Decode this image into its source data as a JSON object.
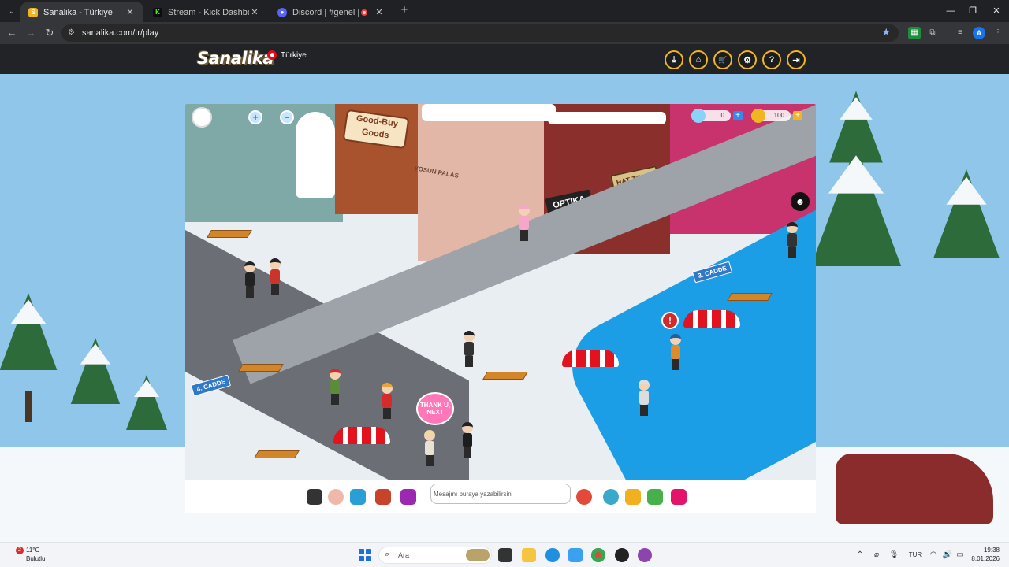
{
  "browser": {
    "tabs": [
      {
        "title": "Sanalika - Türkiye",
        "active": true,
        "favicon_color": "#f1b520"
      },
      {
        "title": "Stream - Kick Dashboard",
        "active": false,
        "favicon_color": "#53fc18"
      },
      {
        "title": "Discord | #genel | survivor",
        "active": false,
        "favicon_color": "#5865f2"
      }
    ],
    "url": "sanalika.com/tr/play",
    "profile_initial": "A"
  },
  "site": {
    "logo_text": "Sanalika",
    "region_label": "Türkiye",
    "header_buttons": [
      {
        "name": "download-icon",
        "glyph": "⤓"
      },
      {
        "name": "home-icon",
        "glyph": "⌂"
      },
      {
        "name": "cart-icon",
        "glyph": "🛒"
      },
      {
        "name": "settings-icon",
        "glyph": "⚙"
      },
      {
        "name": "help-icon",
        "glyph": "?"
      },
      {
        "name": "logout-icon",
        "glyph": "⇥"
      }
    ]
  },
  "game": {
    "diamonds": "0",
    "coins": "100",
    "signs": {
      "good_buy_line1": "Good-Buy",
      "good_buy_line2": "Goods",
      "yosun_palas": "YOSUN PALAS",
      "optika": "OPTIKA",
      "hat_trick": "HAT-TRICK",
      "cadde_3": "3. CADDE",
      "cadde_4": "4. CADDE"
    },
    "speech_bubble": "THANK U, NEXT"
  },
  "chat": {
    "placeholder": "Mesajını buraya yazabilirsin"
  },
  "taskbar": {
    "weather_temp": "11°C",
    "weather_condition": "Bulutlu",
    "notification_count": "2",
    "search_placeholder": "Ara",
    "language": "TUR",
    "time": "19:38",
    "date": "8.01.2026"
  },
  "colors": {
    "accent_gold": "#f1b520",
    "sea": "#1c9ee6",
    "snow": "#f4f8fb"
  }
}
